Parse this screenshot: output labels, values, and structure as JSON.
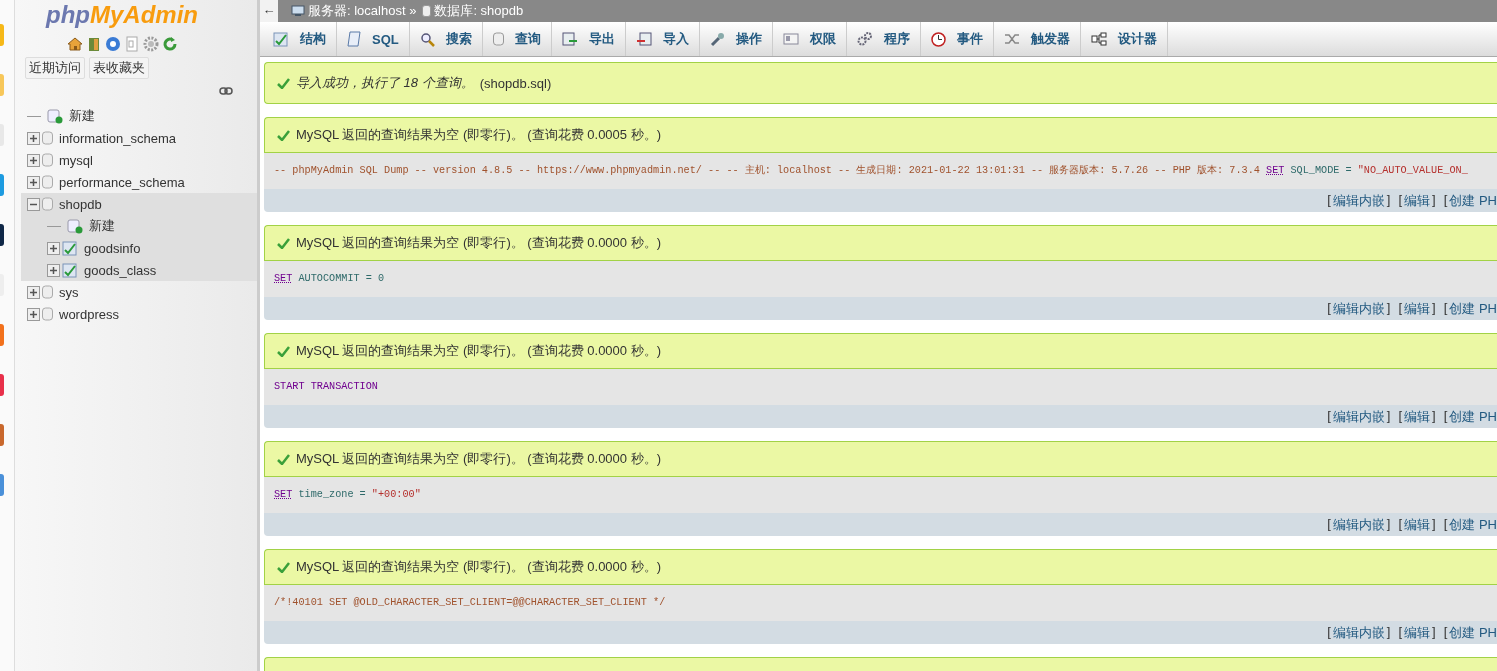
{
  "logo": [
    "php",
    "MyAdmin"
  ],
  "nav_buttons": [
    "近期访问",
    "表收藏夹"
  ],
  "tree": [
    {
      "kind": "new",
      "label": "新建",
      "selected": false
    },
    {
      "kind": "db",
      "label": "information_schema",
      "expanded": false,
      "selected": false
    },
    {
      "kind": "db",
      "label": "mysql",
      "expanded": false,
      "selected": false
    },
    {
      "kind": "db",
      "label": "performance_schema",
      "expanded": false,
      "selected": false
    },
    {
      "kind": "db",
      "label": "shopdb",
      "expanded": true,
      "selected": true,
      "children": [
        {
          "kind": "new",
          "label": "新建"
        },
        {
          "kind": "table",
          "label": "goodsinfo",
          "expanded": false
        },
        {
          "kind": "table",
          "label": "goods_class",
          "expanded": false
        }
      ]
    },
    {
      "kind": "db",
      "label": "sys",
      "expanded": false,
      "selected": false
    },
    {
      "kind": "db",
      "label": "wordpress",
      "expanded": false,
      "selected": false
    }
  ],
  "breadcrumb": {
    "back": "←",
    "server": "服务器: localhost »",
    "database": "数据库: shopdb"
  },
  "tabs": [
    {
      "label": "结构",
      "selected": false
    },
    {
      "label": "SQL",
      "selected": false
    },
    {
      "label": "搜索",
      "selected": false
    },
    {
      "label": "查询",
      "selected": false
    },
    {
      "label": "导出",
      "selected": false
    },
    {
      "label": "导入",
      "selected": false
    },
    {
      "label": "操作",
      "selected": false
    },
    {
      "label": "权限",
      "selected": false
    },
    {
      "label": "程序",
      "selected": false
    },
    {
      "label": "事件",
      "selected": false
    },
    {
      "label": "触发器",
      "selected": false
    },
    {
      "label": "设计器",
      "selected": false
    }
  ],
  "success": {
    "message": "导入成功，执行了 18 个查询。",
    "file": "(shopdb.sql)"
  },
  "results": [
    {
      "message": "MySQL 返回的查询结果为空 (即零行)。 (查询花费 0.0005 秒。)",
      "code": [
        {
          "kind": "comment",
          "text": "-- phpMyAdmin SQL Dump -- version 4.8.5 -- https://www.phpmyadmin.net/ -- -- 主机: localhost -- 生成日期: 2021-01-22 13:01:31 -- 服务器版本: 5.7.26 -- PHP 版本: 7.3.4"
        },
        {
          "kind": "keyword",
          "text": "SET"
        },
        {
          "kind": "plain",
          "text": "SQL_MODE ="
        },
        {
          "kind": "string",
          "text": "\"NO_AUTO_VALUE_ON_"
        }
      ],
      "links": [
        {
          "before": "[",
          "label": "编辑内嵌",
          "after": "]"
        },
        {
          "before": "[",
          "label": "编辑",
          "after": "]"
        },
        {
          "before": "[",
          "label": "创建 PH"
        }
      ]
    },
    {
      "message": "MySQL 返回的查询结果为空 (即零行)。 (查询花费 0.0000 秒。)",
      "code": [
        {
          "kind": "keyword",
          "text": "SET"
        },
        {
          "kind": "plain",
          "text": "AUTOCOMMIT = 0"
        }
      ],
      "links": [
        {
          "before": "[",
          "label": "编辑内嵌",
          "after": "]"
        },
        {
          "before": "[",
          "label": "编辑",
          "after": "]"
        },
        {
          "before": "[",
          "label": "创建 PH"
        }
      ]
    },
    {
      "message": "MySQL 返回的查询结果为空 (即零行)。 (查询花费 0.0000 秒。)",
      "code": [
        {
          "kind": "statement",
          "text": "START TRANSACTION"
        }
      ],
      "links": [
        {
          "before": "[",
          "label": "编辑内嵌",
          "after": "]"
        },
        {
          "before": "[",
          "label": "编辑",
          "after": "]"
        },
        {
          "before": "[",
          "label": "创建 PH"
        }
      ]
    },
    {
      "message": "MySQL 返回的查询结果为空 (即零行)。 (查询花费 0.0000 秒。)",
      "code": [
        {
          "kind": "keyword",
          "text": "SET"
        },
        {
          "kind": "plain",
          "text": "time_zone ="
        },
        {
          "kind": "string",
          "text": "\"+00:00\""
        }
      ],
      "links": [
        {
          "before": "[",
          "label": "编辑内嵌",
          "after": "]"
        },
        {
          "before": "[",
          "label": "编辑",
          "after": "]"
        },
        {
          "before": "[",
          "label": "创建 PH"
        }
      ]
    },
    {
      "message": "MySQL 返回的查询结果为空 (即零行)。 (查询花费 0.0000 秒。)",
      "code": [
        {
          "kind": "comment",
          "text": "/*!40101 SET @OLD_CHARACTER_SET_CLIENT=@@CHARACTER_SET_CLIENT */"
        }
      ],
      "links": [
        {
          "before": "[",
          "label": "编辑内嵌",
          "after": "]"
        },
        {
          "before": "[",
          "label": "编辑",
          "after": "]"
        },
        {
          "before": "[",
          "label": "创建 PH"
        }
      ]
    }
  ]
}
